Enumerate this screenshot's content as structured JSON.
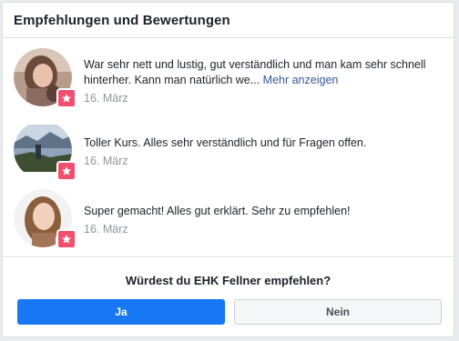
{
  "header": {
    "title": "Empfehlungen und Bewertungen"
  },
  "reviews": [
    {
      "text": "War sehr nett und lustig, gut verständlich und man kam sehr schnell hinterher. Kann man natürlich we...",
      "more_label": "Mehr anzeigen",
      "date": "16. März",
      "badge_icon": "star-icon",
      "avatar": "reviewer-avatar-1"
    },
    {
      "text": "Toller Kurs. Alles sehr verständlich und für Fragen offen.",
      "date": "16. März",
      "badge_icon": "star-icon",
      "avatar": "reviewer-avatar-2"
    },
    {
      "text": "Super gemacht! Alles gut erklärt. Sehr zu empfehlen!",
      "date": "16. März",
      "badge_icon": "star-icon",
      "avatar": "reviewer-avatar-3"
    }
  ],
  "recommend": {
    "question": "Würdest du EHK Fellner empfehlen?",
    "yes_label": "Ja",
    "no_label": "Nein"
  },
  "colors": {
    "badge": "#f0506e",
    "link": "#365899",
    "primary_button": "#1877f2",
    "secondary_button": "#f5f6f7"
  }
}
